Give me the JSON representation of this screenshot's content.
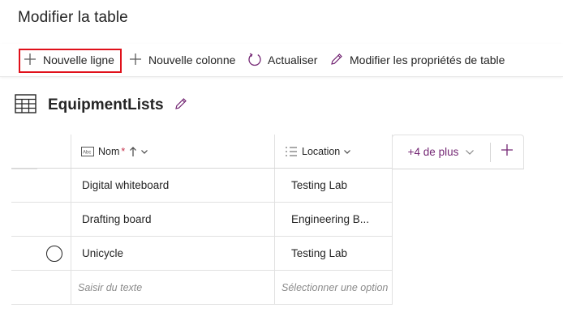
{
  "page": {
    "title": "Modifier la table"
  },
  "toolbar": {
    "new_row_label": "Nouvelle ligne",
    "new_column_label": "Nouvelle colonne",
    "refresh_label": "Actualiser",
    "edit_props_label": "Modifier les propriétés de table"
  },
  "table": {
    "name": "EquipmentLists",
    "columns": {
      "nom": {
        "label": "Nom",
        "required_mark": "*"
      },
      "location": {
        "label": "Location"
      }
    },
    "rows": [
      {
        "nom": "Digital whiteboard",
        "location": "Testing Lab"
      },
      {
        "nom": "Drafting board",
        "location": "Engineering B..."
      },
      {
        "nom": "Unicycle",
        "location": "Testing Lab"
      }
    ],
    "new_row": {
      "nom_placeholder": "Saisir du texte",
      "location_placeholder": "Sélectionner une option"
    },
    "more_columns_label": "+4 de plus"
  },
  "colors": {
    "accent": "#742774",
    "highlight": "#e0101a",
    "text": "#242424"
  },
  "icons": {
    "new_row": "plus-icon",
    "new_column": "plus-icon",
    "refresh": "refresh-icon",
    "edit_props": "pencil-icon",
    "table": "table-grid-icon",
    "edit_name": "pencil-icon",
    "nom_type": "text-field-icon",
    "location_type": "choice-list-icon",
    "sort": "sort-arrow-icon",
    "add_column": "plus-icon"
  }
}
